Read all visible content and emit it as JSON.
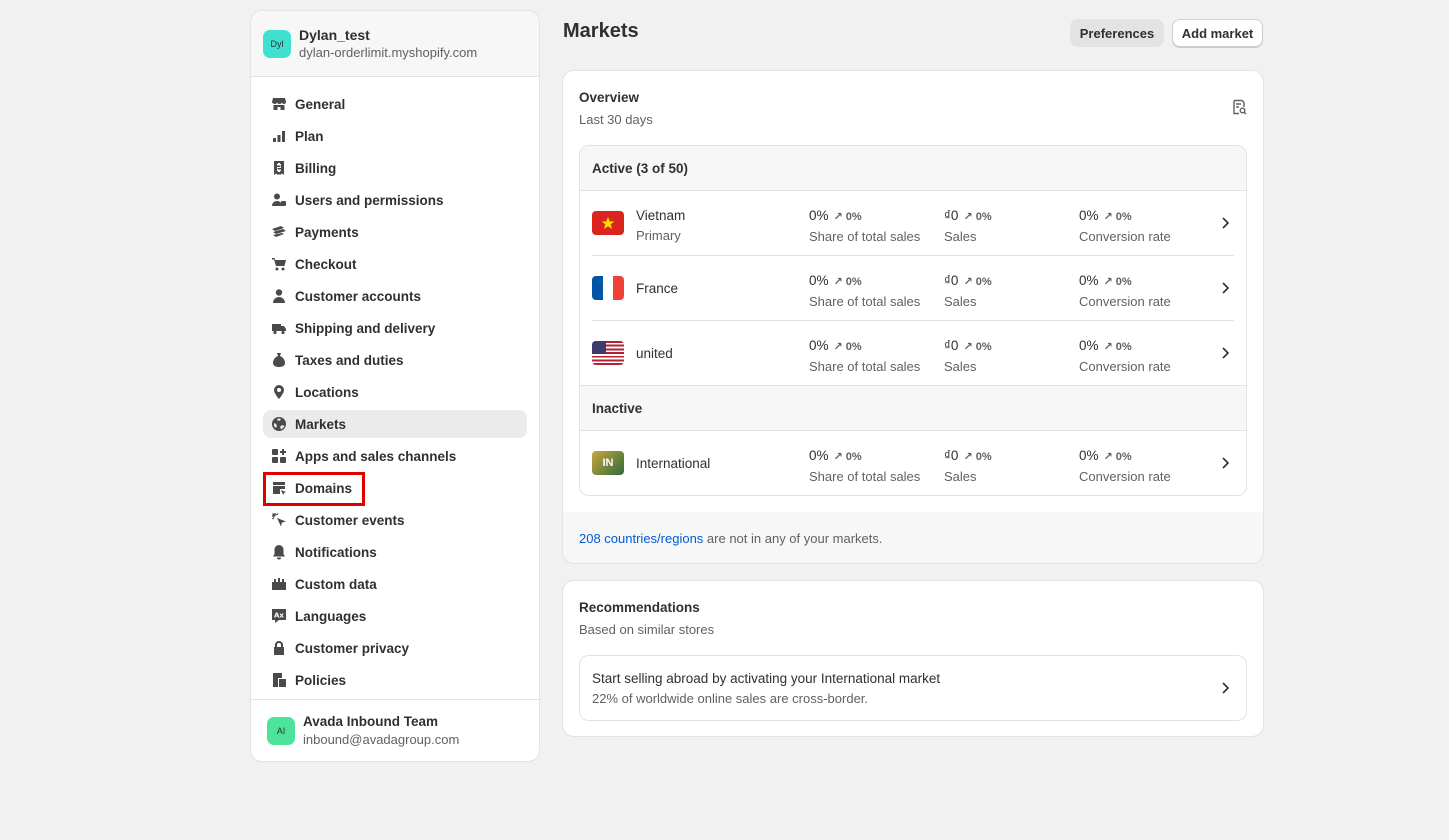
{
  "store": {
    "avatar": "Dyl",
    "name": "Dylan_test",
    "domain": "dylan-orderlimit.myshopify.com"
  },
  "nav": [
    {
      "label": "General",
      "icon": "store-icon"
    },
    {
      "label": "Plan",
      "icon": "plan-icon"
    },
    {
      "label": "Billing",
      "icon": "billing-icon"
    },
    {
      "label": "Users and permissions",
      "icon": "users-icon"
    },
    {
      "label": "Payments",
      "icon": "payments-icon"
    },
    {
      "label": "Checkout",
      "icon": "cart-icon"
    },
    {
      "label": "Customer accounts",
      "icon": "person-icon"
    },
    {
      "label": "Shipping and delivery",
      "icon": "truck-icon"
    },
    {
      "label": "Taxes and duties",
      "icon": "taxes-icon"
    },
    {
      "label": "Locations",
      "icon": "location-icon"
    },
    {
      "label": "Markets",
      "icon": "globe-icon",
      "active": true
    },
    {
      "label": "Apps and sales channels",
      "icon": "apps-icon"
    },
    {
      "label": "Domains",
      "icon": "domains-icon",
      "highlighted": true
    },
    {
      "label": "Customer events",
      "icon": "cursor-icon"
    },
    {
      "label": "Notifications",
      "icon": "bell-icon"
    },
    {
      "label": "Custom data",
      "icon": "custom-data-icon"
    },
    {
      "label": "Languages",
      "icon": "language-icon"
    },
    {
      "label": "Customer privacy",
      "icon": "lock-icon"
    },
    {
      "label": "Policies",
      "icon": "policies-icon"
    }
  ],
  "user": {
    "avatar": "AI",
    "name": "Avada Inbound Team",
    "email": "inbound@avadagroup.com"
  },
  "header": {
    "title": "Markets",
    "preferences_label": "Preferences",
    "add_market_label": "Add market"
  },
  "overview": {
    "title": "Overview",
    "subtitle": "Last 30 days",
    "active_heading": "Active (3 of 50)",
    "inactive_heading": "Inactive",
    "active_markets": [
      {
        "name": "Vietnam",
        "sub": "Primary",
        "flag": "vn",
        "share": "0%",
        "share_delta": "0%",
        "sales": "₫0",
        "sales_delta": "0%",
        "conv": "0%",
        "conv_delta": "0%"
      },
      {
        "name": "France",
        "sub": "",
        "flag": "fr",
        "share": "0%",
        "share_delta": "0%",
        "sales": "₫0",
        "sales_delta": "0%",
        "conv": "0%",
        "conv_delta": "0%"
      },
      {
        "name": "united",
        "sub": "",
        "flag": "us",
        "share": "0%",
        "share_delta": "0%",
        "sales": "₫0",
        "sales_delta": "0%",
        "conv": "0%",
        "conv_delta": "0%"
      }
    ],
    "inactive_markets": [
      {
        "name": "International",
        "sub": "",
        "flag": "in",
        "flag_text": "IN",
        "share": "0%",
        "share_delta": "0%",
        "sales": "₫0",
        "sales_delta": "0%",
        "conv": "0%",
        "conv_delta": "0%"
      }
    ],
    "labels": {
      "share": "Share of total sales",
      "sales": "Sales",
      "conv": "Conversion rate"
    },
    "footer_link": "208 countries/regions",
    "footer_text": " are not in any of your markets."
  },
  "recommendations": {
    "title": "Recommendations",
    "subtitle": "Based on similar stores",
    "item_title": "Start selling abroad by activating your International market",
    "item_sub": "22% of worldwide online sales are cross-border."
  },
  "colors": {
    "link": "#005bd3",
    "highlight": "#e00000",
    "store_avatar": "#3ee0d0",
    "user_avatar": "#4ee39a"
  }
}
